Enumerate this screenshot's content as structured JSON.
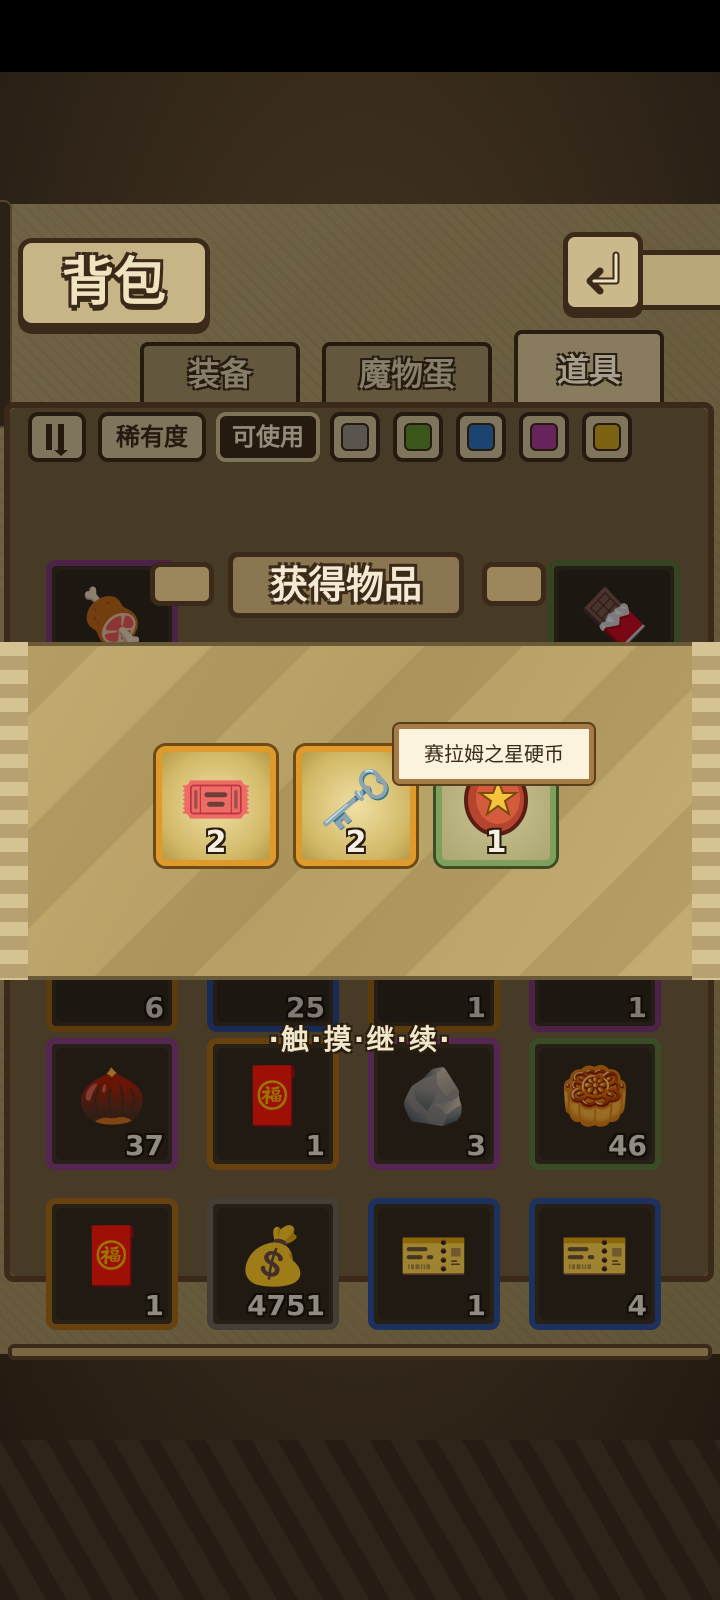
{
  "header": {
    "title": "背包",
    "back_icon": "return-arrow-icon"
  },
  "tabs": [
    {
      "label": "装备",
      "active": false
    },
    {
      "label": "魔物蛋",
      "active": false
    },
    {
      "label": "道具",
      "active": true
    }
  ],
  "filters": {
    "sort_icon": "sort-order-icon",
    "rarity_label": "稀有度",
    "usable_label": "可使用",
    "color_swatches": [
      "#8e8a80",
      "#5d8a2c",
      "#2c6fb5",
      "#a53a93",
      "#c99e1c"
    ]
  },
  "overlay": {
    "title": "获得物品",
    "rewards": [
      {
        "name": "ticket-icon",
        "count": "2",
        "rarity": "orange"
      },
      {
        "name": "golden-key-icon",
        "count": "2",
        "rarity": "orange"
      },
      {
        "name": "star-coin-icon",
        "count": "1",
        "rarity": "green"
      }
    ],
    "tooltip": "赛拉姆之星硬币",
    "touch_hint": "·触·摸·继·续·"
  },
  "inventory": {
    "partial_row_counts": [
      "6",
      "25",
      "1",
      "1"
    ],
    "rows": [
      [
        {
          "name": "seed-icon",
          "count": "37",
          "rarity": "purple"
        },
        {
          "name": "red-envelope-icon",
          "count": "1",
          "rarity": "orange"
        },
        {
          "name": "ore-rock-icon",
          "count": "3",
          "rarity": "purple"
        },
        {
          "name": "mooncake-icon",
          "count": "46",
          "rarity": "green"
        }
      ],
      [
        {
          "name": "red-envelope-icon",
          "count": "1",
          "rarity": "orange"
        },
        {
          "name": "coin-bag-icon",
          "count": "4751",
          "rarity": "gray"
        },
        {
          "name": "monster-ticket-icon",
          "count": "1",
          "rarity": "blue"
        },
        {
          "name": "monster-ticket-icon",
          "count": "4",
          "rarity": "blue"
        }
      ]
    ]
  }
}
